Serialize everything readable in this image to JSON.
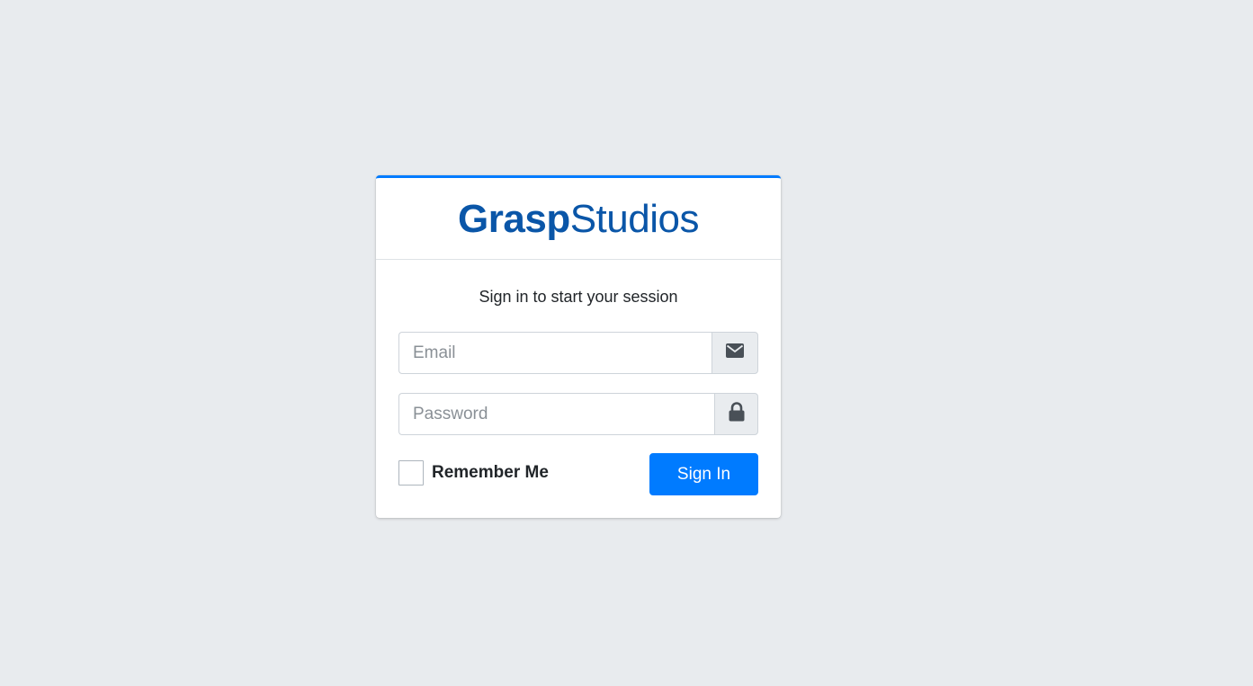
{
  "brand": {
    "bold_part": "Grasp",
    "light_part": "Studios",
    "color": "#0a56a8"
  },
  "login": {
    "message": "Sign in to start your session",
    "email": {
      "placeholder": "Email",
      "value": "",
      "icon": "envelope-icon"
    },
    "password": {
      "placeholder": "Password",
      "value": "",
      "icon": "lock-icon"
    },
    "remember_label": "Remember Me",
    "remember_checked": false,
    "submit_label": "Sign In"
  },
  "colors": {
    "accent": "#007bff",
    "background": "#e8ebee"
  }
}
